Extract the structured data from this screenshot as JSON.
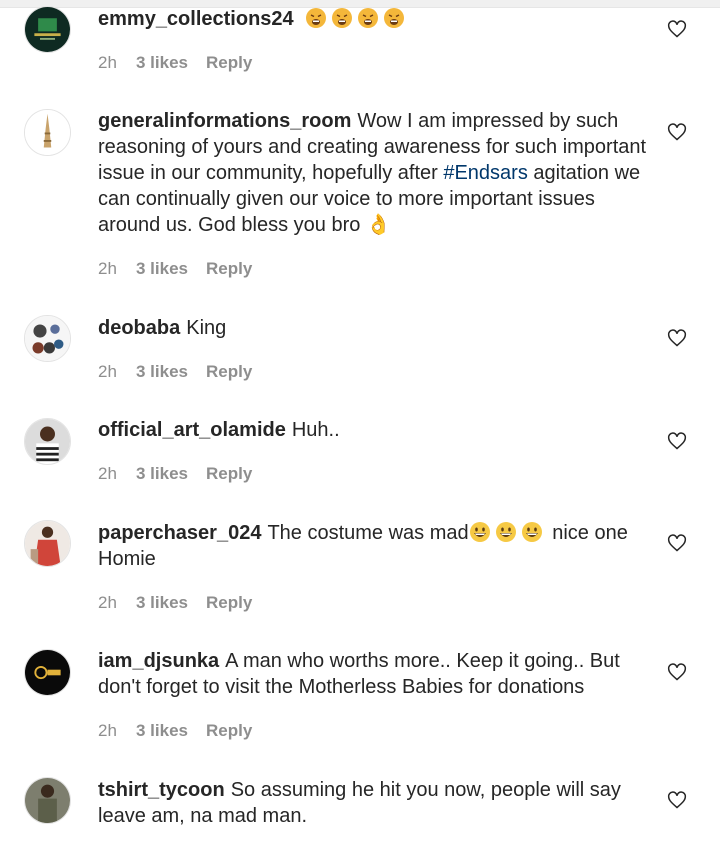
{
  "colors": {
    "text": "#262626",
    "muted": "#8e8e8e",
    "hashtag": "#00376b"
  },
  "comments": [
    {
      "username": "emmy_collections24",
      "text": "",
      "emoji_after": [
        "tired-face-emoji",
        "tired-face-emoji",
        "tired-face-emoji",
        "tired-face-emoji"
      ],
      "time": "2h",
      "likes": "3 likes",
      "reply": "Reply"
    },
    {
      "username": "generalinformations_room",
      "text_before": "Wow I am impressed by such reasoning of yours and creating awareness for such important issue in our community, hopefully after ",
      "hashtag": "#Endsars",
      "text_after": " agitation we can continually given our voice to more important issues around us. God bless you bro 👌",
      "time": "2h",
      "likes": "3 likes",
      "reply": "Reply"
    },
    {
      "username": "deobaba",
      "text": "King",
      "time": "2h",
      "likes": "3 likes",
      "reply": "Reply"
    },
    {
      "username": "official_art_olamide",
      "text": "Huh..",
      "time": "2h",
      "likes": "3 likes",
      "reply": "Reply"
    },
    {
      "username": "paperchaser_024",
      "text_before": "The costume was mad",
      "text_after": " nice one Homie",
      "emoji_mid": [
        "grinning-face-emoji",
        "grinning-face-emoji",
        "grinning-face-emoji"
      ],
      "time": "2h",
      "likes": "3 likes",
      "reply": "Reply"
    },
    {
      "username": "iam_djsunka",
      "text": "A man who worths more.. Keep it going.. But don't forget to visit the Motherless Babies for donations",
      "time": "2h",
      "likes": "3 likes",
      "reply": "Reply"
    },
    {
      "username": "tshirt_tycoon",
      "text": "So assuming he hit you now, people will say leave am, na mad man."
    }
  ],
  "icons": {
    "like": "heart-outline-icon"
  }
}
